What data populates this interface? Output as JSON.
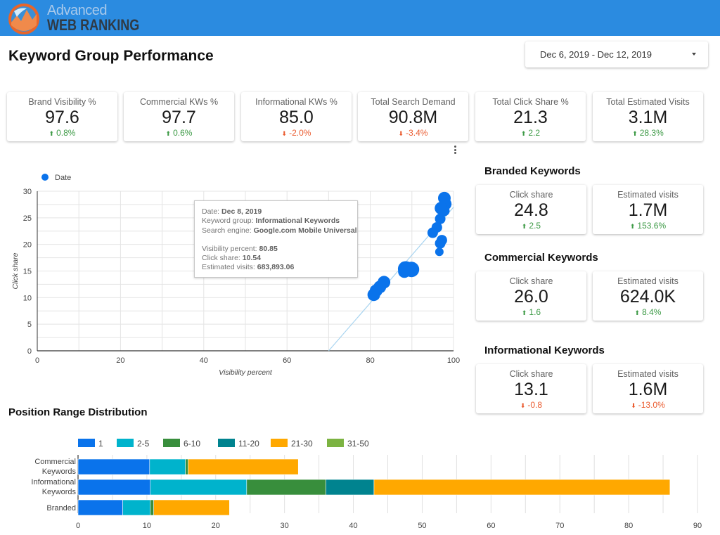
{
  "header": {
    "logo_line1": "Advanced",
    "logo_line2": "WEB RANKING",
    "brand_color": "#2b8be0"
  },
  "page": {
    "title": "Keyword Group Performance",
    "date_range": "Dec 6, 2019 - Dec 12, 2019"
  },
  "kpis": [
    {
      "label": "Brand Visibility %",
      "value": "97.6",
      "delta": "0.8%",
      "direction": "up"
    },
    {
      "label": "Commercial KWs %",
      "value": "97.7",
      "delta": "0.6%",
      "direction": "up"
    },
    {
      "label": "Informational KWs %",
      "value": "85.0",
      "delta": "-2.0%",
      "direction": "down"
    },
    {
      "label": "Total Search Demand",
      "value": "90.8M",
      "delta": "-3.4%",
      "direction": "down"
    },
    {
      "label": "Total Click Share %",
      "value": "21.3",
      "delta": "2.2",
      "direction": "up"
    },
    {
      "label": "Total Estimated Visits",
      "value": "3.1M",
      "delta": "28.3%",
      "direction": "up"
    }
  ],
  "groups": [
    {
      "title": "Branded Keywords",
      "cards": [
        {
          "label": "Click share",
          "value": "24.8",
          "delta": "2.5",
          "direction": "up"
        },
        {
          "label": "Estimated visits",
          "value": "1.7M",
          "delta": "153.6%",
          "direction": "up"
        }
      ]
    },
    {
      "title": "Commercial Keywords",
      "cards": [
        {
          "label": "Click share",
          "value": "26.0",
          "delta": "1.6",
          "direction": "up"
        },
        {
          "label": "Estimated visits",
          "value": "624.0K",
          "delta": "8.4%",
          "direction": "up"
        }
      ]
    },
    {
      "title": "Informational Keywords",
      "cards": [
        {
          "label": "Click share",
          "value": "13.1",
          "delta": "-0.8",
          "direction": "down"
        },
        {
          "label": "Estimated visits",
          "value": "1.6M",
          "delta": "-13.0%",
          "direction": "down"
        }
      ]
    }
  ],
  "tooltip": {
    "date_label": "Date: ",
    "date_value": "Dec 8, 2019",
    "group_label": "Keyword group: ",
    "group_value": "Informational Keywords",
    "engine_label": "Search engine: ",
    "engine_value": "Google.com Mobile Universal",
    "vis_label": "Visibility percent: ",
    "vis_value": "80.85",
    "click_label": "Click share: ",
    "click_value": "10.54",
    "visits_label": "Estimated visits: ",
    "visits_value": "683,893.06"
  },
  "position_section_title": "Position Range Distribution",
  "colors": {
    "up": "#3d9a46",
    "down": "#ea5b2f",
    "bubble": "#0a73eb",
    "trend": "#a8d4f0"
  },
  "chart_data": [
    {
      "type": "scatter",
      "title": "",
      "xlabel": "Visibility percent",
      "ylabel": "Click share",
      "xlim": [
        0,
        100
      ],
      "ylim": [
        0,
        30
      ],
      "xticks": [
        "0",
        "20",
        "40",
        "60",
        "80",
        "100"
      ],
      "yticks": [
        "0",
        "5",
        "10",
        "15",
        "20",
        "25",
        "30"
      ],
      "grid": true,
      "legend": {
        "position": "top-left",
        "entries": [
          "Date"
        ]
      },
      "series": [
        {
          "name": "Date",
          "points": [
            {
              "x": 97.8,
              "y": 28.7,
              "size": 3
            },
            {
              "x": 98.0,
              "y": 27.6,
              "size": 3
            },
            {
              "x": 97.0,
              "y": 26.8,
              "size": 3
            },
            {
              "x": 97.8,
              "y": 26.3,
              "size": 2
            },
            {
              "x": 96.8,
              "y": 24.8,
              "size": 2
            },
            {
              "x": 96.0,
              "y": 23.2,
              "size": 2
            },
            {
              "x": 95.0,
              "y": 22.2,
              "size": 2
            },
            {
              "x": 97.2,
              "y": 20.8,
              "size": 2
            },
            {
              "x": 96.8,
              "y": 20.2,
              "size": 2
            },
            {
              "x": 96.6,
              "y": 18.6,
              "size": 1
            },
            {
              "x": 83.3,
              "y": 12.9,
              "size": 3
            },
            {
              "x": 82.3,
              "y": 12.0,
              "size": 3
            },
            {
              "x": 81.4,
              "y": 11.3,
              "size": 3
            },
            {
              "x": 80.85,
              "y": 10.54,
              "size": 3
            },
            {
              "x": 88.5,
              "y": 15.4,
              "size": 4
            },
            {
              "x": 89.9,
              "y": 15.3,
              "size": 4
            },
            {
              "x": 88.2,
              "y": 14.9,
              "size": 3
            }
          ]
        }
      ],
      "trendline": {
        "from": [
          70,
          0
        ],
        "to": [
          100,
          27
        ]
      }
    },
    {
      "type": "bar",
      "orientation": "horizontal",
      "stacked": true,
      "title": "Position Range Distribution",
      "categories": [
        "Commercial Keywords",
        "Informational Keywords",
        "Branded"
      ],
      "category_lines": [
        [
          "Commercial",
          "Keywords"
        ],
        [
          "Informational",
          "Keywords"
        ],
        [
          "Branded"
        ]
      ],
      "xlim": [
        0,
        90
      ],
      "xticks": [
        "0",
        "10",
        "20",
        "30",
        "40",
        "50",
        "60",
        "70",
        "80",
        "90"
      ],
      "legend": {
        "position": "top"
      },
      "series": [
        {
          "name": "1",
          "color": "#0a73eb",
          "values": [
            10.4,
            10.5,
            6.5
          ]
        },
        {
          "name": "2-5",
          "color": "#00b3cc",
          "values": [
            5.2,
            14.0,
            4.0
          ]
        },
        {
          "name": "6-10",
          "color": "#388e3c",
          "values": [
            0.4,
            11.5,
            0.5
          ]
        },
        {
          "name": "11-20",
          "color": "#00838f",
          "values": [
            0,
            7.0,
            0
          ]
        },
        {
          "name": "21-30",
          "color": "#ffa800",
          "values": [
            16.0,
            43.0,
            11.0
          ]
        },
        {
          "name": "31-50",
          "color": "#7cb342",
          "values": [
            0,
            0,
            0
          ]
        }
      ]
    }
  ]
}
